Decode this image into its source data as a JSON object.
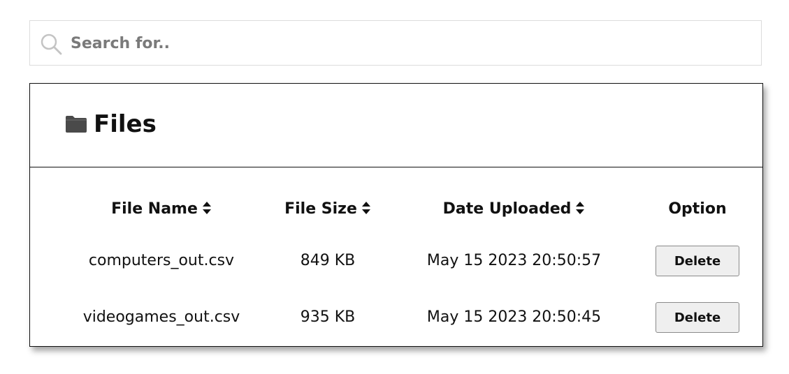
{
  "search": {
    "placeholder": "Search for.."
  },
  "files_panel": {
    "title": "Files",
    "icon": "folder-icon",
    "columns": [
      {
        "label": "File Name",
        "sortable": true
      },
      {
        "label": "File Size",
        "sortable": true
      },
      {
        "label": "Date Uploaded",
        "sortable": true
      },
      {
        "label": "Option",
        "sortable": false
      }
    ],
    "rows": [
      {
        "file_name": "computers_out.csv",
        "file_size": "849 KB",
        "date_uploaded": "May 15 2023 20:50:57",
        "action_label": "Delete"
      },
      {
        "file_name": "videogames_out.csv",
        "file_size": "935 KB",
        "date_uploaded": "May 15 2023 20:50:45",
        "action_label": "Delete"
      }
    ]
  },
  "colors": {
    "border_dark": "#111111",
    "search_border": "#dcdcdc",
    "button_bg": "#efefef",
    "icon_gray": "#4a4a4a",
    "placeholder_gray": "#7a7a7a"
  }
}
